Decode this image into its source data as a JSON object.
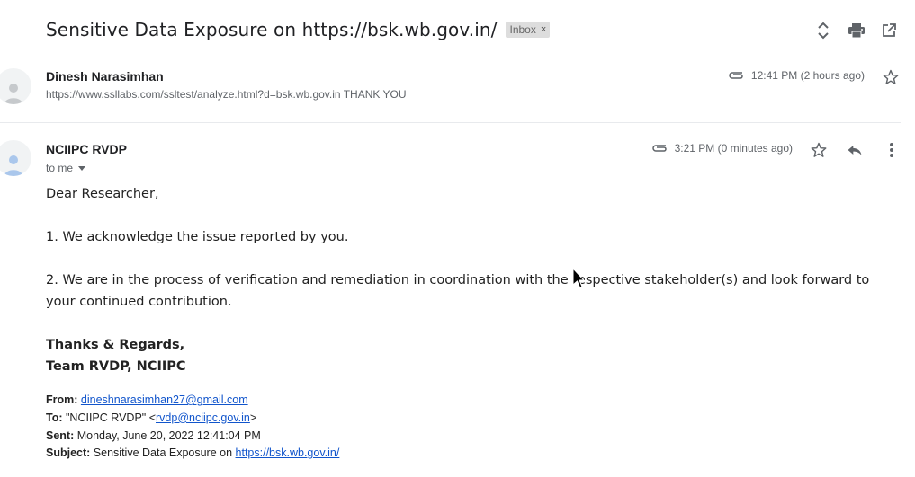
{
  "thread": {
    "subject": "Sensitive Data Exposure on https://bsk.wb.gov.in/",
    "label": "Inbox",
    "label_remove": "×"
  },
  "icons": {
    "expand": "expand-collapse-icon",
    "print": "print-icon",
    "popout": "open-in-new-window-icon",
    "star": "star-icon",
    "reply": "reply-icon",
    "more": "more-vertical-icon",
    "attachment": "paperclip-icon"
  },
  "message1": {
    "sender": "Dinesh Narasimhan",
    "snippet": "https://www.ssllabs.com/ssltest/analyze.html?d=bsk.wb.gov.in THANK YOU",
    "time": "12:41 PM (2 hours ago)"
  },
  "message2": {
    "sender": "NCIIPC RVDP",
    "recipient": "to me",
    "time": "3:21 PM (0 minutes ago)",
    "body": {
      "greeting": "Dear Researcher,",
      "p1": "1. We acknowledge the issue reported by you.",
      "p2": "2. We are in the process of verification and remediation in coordination with the respective stakeholder(s) and look forward to your continued contribution.",
      "sign1": "Thanks & Regards,",
      "sign2": "Team RVDP, NCIIPC"
    },
    "quoted": {
      "from_label": "From:",
      "from_value": "dineshnarasimhan27@gmail.com",
      "to_label": "To:",
      "to_name": "\"NCIIPC RVDP\" <",
      "to_email": "rvdp@nciipc.gov.in",
      "to_close": ">",
      "sent_label": "Sent:",
      "sent_value": "Monday, June 20, 2022 12:41:04 PM",
      "subject_label": "Subject:",
      "subject_text": "Sensitive Data Exposure on ",
      "subject_link": "https://bsk.wb.gov.in/"
    }
  },
  "colors": {
    "link": "#1155cc",
    "muted": "#5f6368",
    "text": "#202124",
    "chip": "#dddddd"
  }
}
